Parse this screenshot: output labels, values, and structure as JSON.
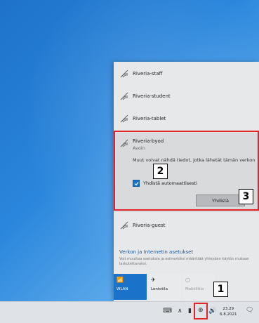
{
  "networks": {
    "staff": "Riveria-staff",
    "student": "Riveria-student",
    "tablet": "Riveria-tablet",
    "guest": "Riveria-guest"
  },
  "expanded": {
    "name": "Riveria-byod",
    "status": "Avoin",
    "description": "Muut voivat nähdä tiedot, jotka lähetät tämän verkon",
    "auto_connect_label": "Yhdistä automaattisesti",
    "auto_connect_checked": true,
    "connect_label": "Yhdistä"
  },
  "settings": {
    "title": "Verkon ja Internetin asetukset",
    "description": "Voit muuttaa asetuksia ja esimerkiksi määrittää yhteyden käytön mukaan laskutettavaksi."
  },
  "tiles": {
    "wlan": "WLAN",
    "flight": "Lentotila",
    "mobile": "Mobiilitila"
  },
  "taskbar": {
    "time": "23.29",
    "date": "6.8.2021"
  },
  "callouts": {
    "one": "1",
    "two": "2",
    "three": "3"
  },
  "colors": {
    "accent": "#1a73c8",
    "highlight": "#e0242a"
  }
}
